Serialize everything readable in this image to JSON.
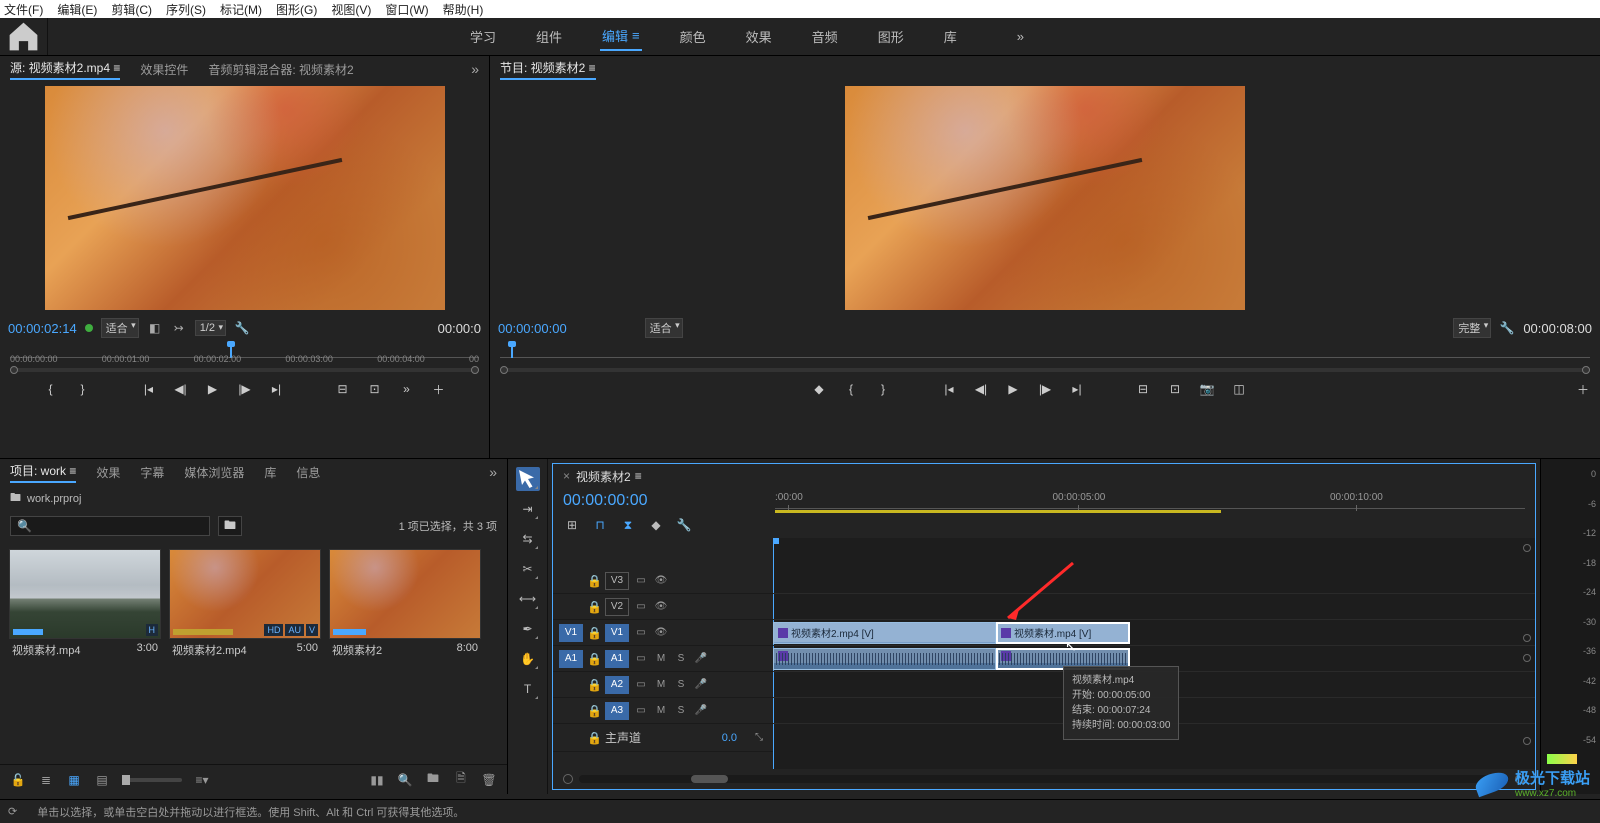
{
  "menu": [
    "文件(F)",
    "编辑(E)",
    "剪辑(C)",
    "序列(S)",
    "标记(M)",
    "图形(G)",
    "视图(V)",
    "窗口(W)",
    "帮助(H)"
  ],
  "workspaces": {
    "items": [
      "学习",
      "组件",
      "编辑",
      "颜色",
      "效果",
      "音频",
      "图形",
      "库"
    ],
    "active_index": 2
  },
  "source": {
    "tabs": [
      "源: 视频素材2.mp4",
      "效果控件",
      "音频剪辑混合器: 视频素材2"
    ],
    "active_tab": 0,
    "timecode": "00:00:02:14",
    "fit": "适合",
    "speed": "1/2",
    "duration": "00:00:0",
    "marks": [
      "00:00:00:00",
      "00:00:01:00",
      "00:00:02:00",
      "00:00:03:00",
      "00:00:04:00",
      "00"
    ]
  },
  "program": {
    "title": "节目: 视频素材2",
    "timecode": "00:00:00:00",
    "fit": "适合",
    "quality": "完整",
    "duration": "00:00:08:00"
  },
  "project": {
    "tabs": [
      "项目: work",
      "效果",
      "字幕",
      "媒体浏览器",
      "库",
      "信息"
    ],
    "active_tab": 0,
    "file": "work.prproj",
    "search_placeholder": "",
    "status": "1 项已选择，共 3 项",
    "bins": [
      {
        "name": "视频素材.mp4",
        "dur": "3:00",
        "thumb": "mountain",
        "sel": false,
        "badges": [
          "H"
        ]
      },
      {
        "name": "视频素材2.mp4",
        "dur": "5:00",
        "thumb": "leaves",
        "sel": false,
        "badges": [
          "HD",
          "AU",
          "V"
        ]
      },
      {
        "name": "视频素材2",
        "dur": "8:00",
        "thumb": "leaves",
        "sel": false,
        "badges": []
      }
    ]
  },
  "tools": [
    "selection",
    "track-select",
    "ripple",
    "razor",
    "slip",
    "pen",
    "hand",
    "type"
  ],
  "timeline": {
    "tab": "视频素材2",
    "timecode": "00:00:00:00",
    "ticks": [
      ":00:00",
      "00:00:05:00",
      "00:00:10:00"
    ],
    "video_tracks": [
      {
        "src": "",
        "name": "V3",
        "on": false
      },
      {
        "src": "",
        "name": "V2",
        "on": false
      },
      {
        "src": "V1",
        "name": "V1",
        "on": true
      }
    ],
    "audio_tracks": [
      {
        "src": "A1",
        "name": "A1",
        "on": true
      },
      {
        "src": "",
        "name": "A2",
        "on": true
      },
      {
        "src": "",
        "name": "A3",
        "on": true
      }
    ],
    "master": {
      "label": "主声道",
      "val": "0.0"
    },
    "clips": [
      {
        "track": "V1",
        "label": "视频素材2.mp4 [V]",
        "start": 0,
        "len": 223,
        "sel": false
      },
      {
        "track": "V1",
        "label": "视频素材.mp4 [V]",
        "start": 223,
        "len": 134,
        "sel": true
      },
      {
        "track": "A1",
        "label": "",
        "start": 0,
        "len": 223,
        "sel": false,
        "audio": true
      },
      {
        "track": "A1",
        "label": "",
        "start": 223,
        "len": 134,
        "sel": true,
        "audio": true
      }
    ],
    "tooltip": {
      "l1": "视频素材.mp4",
      "l2": "开始: 00:00:05:00",
      "l3": "结束: 00:00:07:24",
      "l4": "持续时间: 00:00:03:00"
    }
  },
  "meters": {
    "scale": [
      "0",
      "-6",
      "-12",
      "-18",
      "-24",
      "-30",
      "-36",
      "-42",
      "-48",
      "-54",
      ""
    ]
  },
  "status": {
    "hint": "单击以选择，或单击空白处并拖动以进行框选。使用 Shift、Alt 和 Ctrl 可获得其他选项。"
  },
  "watermark": {
    "t1": "极光下载站",
    "t2": "www.xz7.com"
  }
}
